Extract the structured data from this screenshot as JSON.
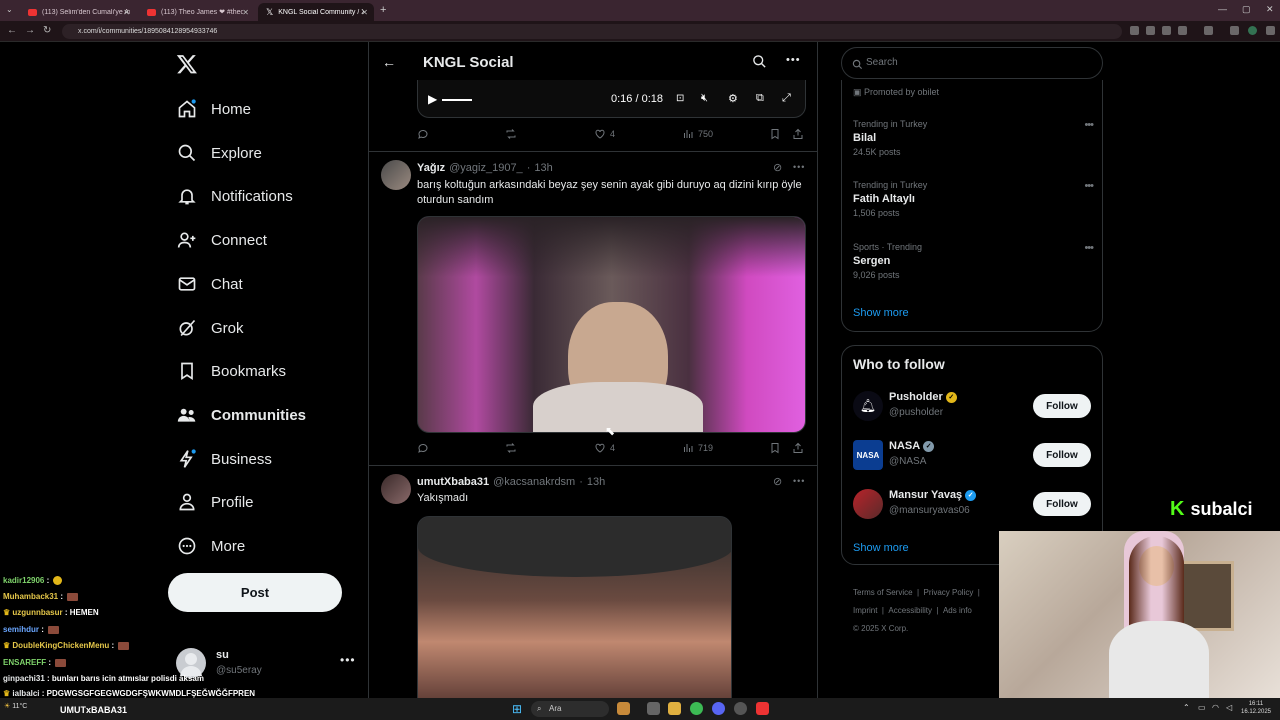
{
  "browser": {
    "tabs": [
      {
        "label": "(113) Selim'den Cumali'ye Anla..."
      },
      {
        "label": "(113) Theo James ❤ #theojam..."
      },
      {
        "label": "KNGL Social Community / X"
      }
    ],
    "url": "x.com/i/communities/1895084128954933746"
  },
  "sidebar": {
    "items": [
      {
        "label": "Home",
        "icon": "home-icon"
      },
      {
        "label": "Explore",
        "icon": "search-icon"
      },
      {
        "label": "Notifications",
        "icon": "bell-icon"
      },
      {
        "label": "Connect",
        "icon": "add-person-icon"
      },
      {
        "label": "Chat",
        "icon": "mail-icon"
      },
      {
        "label": "Grok",
        "icon": "grok-icon"
      },
      {
        "label": "Bookmarks",
        "icon": "bookmark-icon"
      },
      {
        "label": "Communities",
        "icon": "communities-icon"
      },
      {
        "label": "Business",
        "icon": "lightning-icon"
      },
      {
        "label": "Profile",
        "icon": "person-icon"
      },
      {
        "label": "More",
        "icon": "more-circle-icon"
      }
    ],
    "post_label": "Post",
    "account": {
      "name": "su",
      "handle": "@su5eray"
    }
  },
  "header": {
    "title": "KNGL Social"
  },
  "video_player": {
    "time": "0:16 / 0:18"
  },
  "tweets": [
    {
      "actions": {
        "likes": "4",
        "views": "750"
      }
    },
    {
      "name": "Yağız",
      "handle": "@yagiz_1907_",
      "time": "13h",
      "text": "barış koltuğun arkasındaki beyaz şey senin ayak gibi duruyo aq dizini kırıp öyle oturdun sandım",
      "actions": {
        "likes": "4",
        "views": "719"
      }
    },
    {
      "name": "umutXbaba31",
      "handle": "@kacsanakrdsm",
      "time": "13h",
      "text": "Yakışmadı"
    }
  ],
  "search": {
    "placeholder": "Search"
  },
  "trends": {
    "promoted": "Promoted by obilet",
    "items": [
      {
        "category": "Trending in Turkey",
        "name": "Bilal",
        "count": "24.5K posts"
      },
      {
        "category": "Trending in Turkey",
        "name": "Fatih Altaylı",
        "count": "1,506 posts"
      },
      {
        "category": "Sports · Trending",
        "name": "Sergen",
        "count": "9,026 posts"
      }
    ],
    "show_more": "Show more"
  },
  "who_to_follow": {
    "title": "Who to follow",
    "accounts": [
      {
        "name": "Pusholder",
        "handle": "@pusholder",
        "verified": "gold"
      },
      {
        "name": "NASA",
        "handle": "@NASA",
        "verified": "gray"
      },
      {
        "name": "Mansur Yavaş",
        "handle": "@mansuryavas06",
        "verified": "blue"
      }
    ],
    "follow_label": "Follow",
    "show_more": "Show more"
  },
  "footer": {
    "links": [
      "Terms of Service",
      "Privacy Policy",
      "Imprint",
      "Accessibility",
      "Ads info"
    ],
    "copyright": "© 2025 X Corp."
  },
  "stream_overlay": {
    "brand": "subalci",
    "chat": [
      {
        "user": "kadir12906",
        "msg": "",
        "color": "#7fd36b"
      },
      {
        "user": "Muhamback31",
        "msg": "",
        "color": "#e6c84a"
      },
      {
        "user": "uzgunnbasur",
        "msg": "HEMEN",
        "color": "#e6c84a"
      },
      {
        "user": "semihdur",
        "msg": "",
        "color": "#6aa6ff"
      },
      {
        "user": "DoubleKingChickenMenu",
        "msg": "",
        "color": "#e6c84a"
      },
      {
        "user": "ENSAREFF",
        "msg": "",
        "color": "#7fd36b"
      },
      {
        "user": "ginpachi31",
        "msg": "bunları barıs icin atmıslar polisdi aksam",
        "color": "#e7e9ea"
      },
      {
        "user": "ialbalci",
        "msg": "PDGWGSGFGEGWGDGFŞWKWMDLFŞEĞWĞĞFPREN",
        "color": "#e7e9ea"
      },
      {
        "user": "",
        "msg": "UMUTxBABA31",
        "color": "#e7e9ea"
      }
    ]
  },
  "taskbar": {
    "search_placeholder": "Ara",
    "clock": "16:11",
    "date": "16.12.2025",
    "weather": "11°C"
  },
  "colors": {
    "accent": "#1d9bf0",
    "background": "#000000",
    "border": "#2f3336",
    "muted": "#71767b"
  }
}
